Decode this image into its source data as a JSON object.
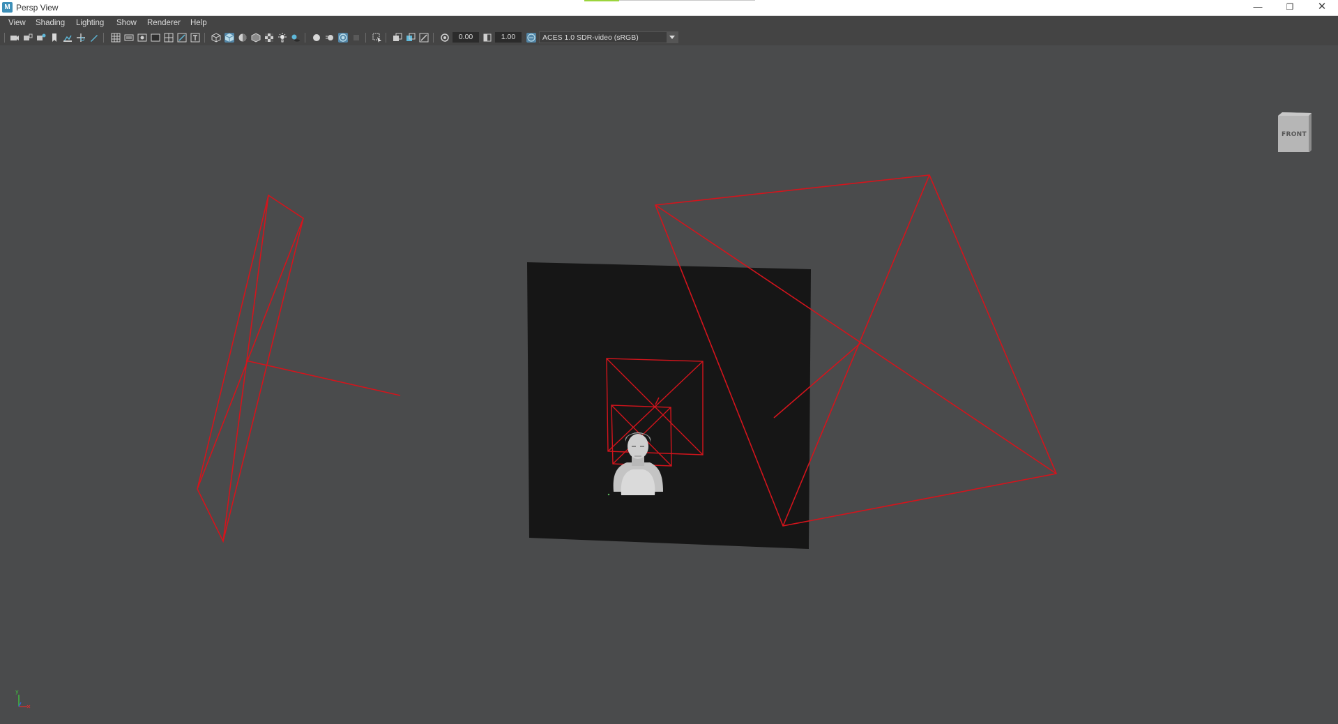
{
  "window": {
    "title": "Persp View",
    "app_icon_letter": "M",
    "minimize_glyph": "—",
    "maximize_glyph": "❐",
    "close_glyph": "✕"
  },
  "menu": {
    "items": [
      "View",
      "Shading",
      "Lighting",
      "Show",
      "Renderer",
      "Help"
    ]
  },
  "toolbar": {
    "exposure_value": "0.00",
    "gamma_value": "1.00",
    "color_space": "ACES 1.0 SDR-video (sRGB)"
  },
  "viewcube": {
    "label": "FRONT"
  },
  "axis": {
    "y_label": "y",
    "x_color": "#d03030",
    "y_color": "#40c040",
    "z_color": "#3060e0"
  },
  "colors": {
    "viewport_background": "#4a4b4c",
    "backdrop_plane": "#161616",
    "camera_wireframe": "#d4141c",
    "active_tool": "#5285a6"
  }
}
